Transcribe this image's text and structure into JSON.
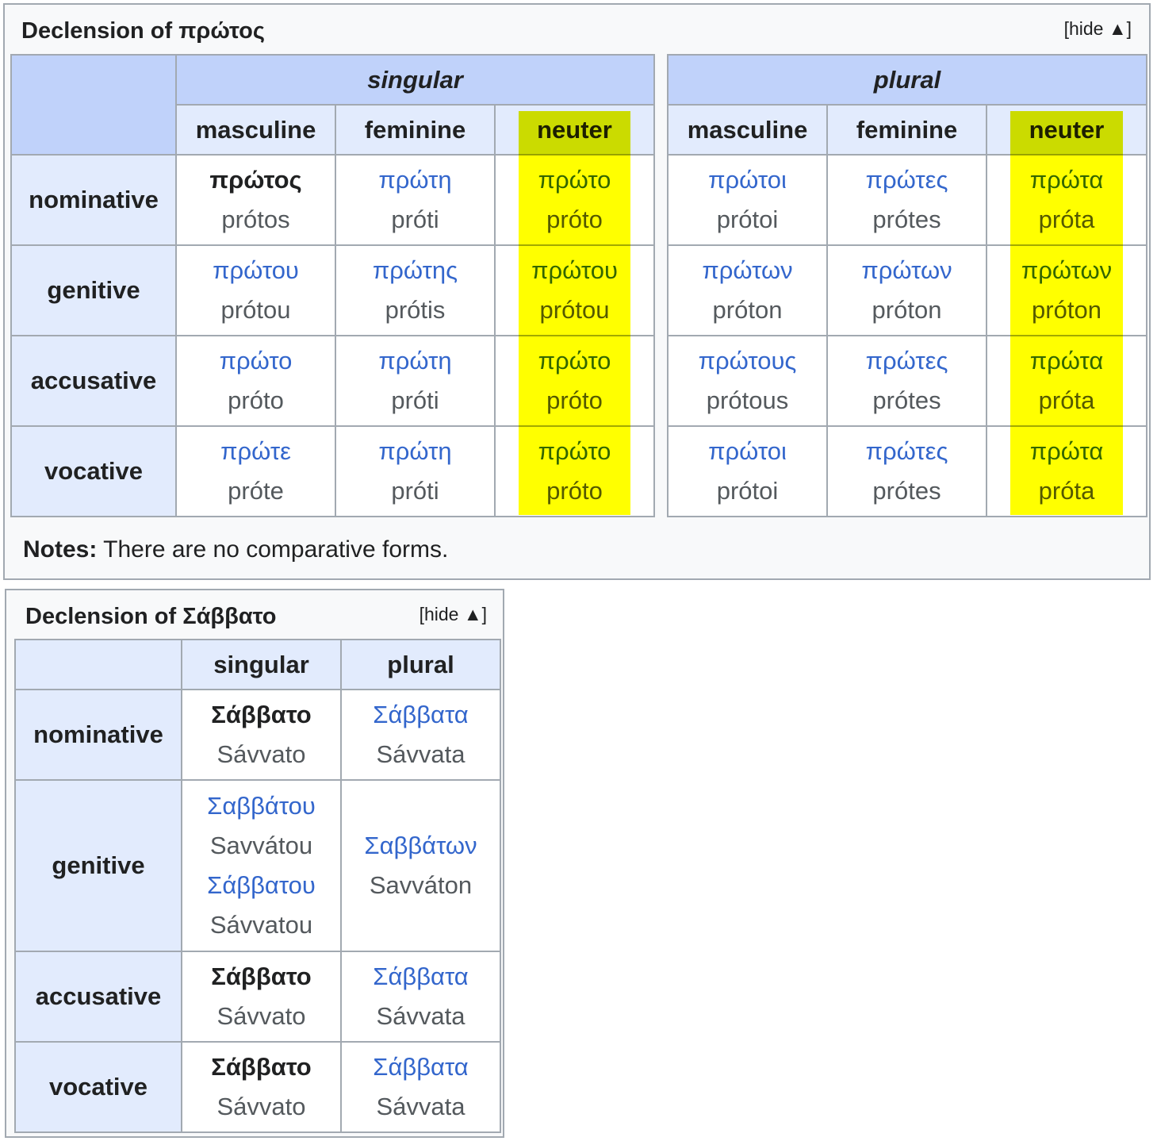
{
  "box1": {
    "title": "Declension of πρώτος",
    "hide_label": "[hide ▲]",
    "singular_label": "singular",
    "plural_label": "plural",
    "genders": [
      "masculine",
      "feminine",
      "neuter"
    ],
    "cases": [
      "nominative",
      "genitive",
      "accusative",
      "vocative"
    ],
    "singular": [
      [
        {
          "g": "πρώτος",
          "t": "prótos"
        },
        {
          "g": "πρώτη",
          "t": "próti"
        },
        {
          "g": "πρώτο",
          "t": "próto"
        }
      ],
      [
        {
          "g": "πρώτου",
          "t": "prótou"
        },
        {
          "g": "πρώτης",
          "t": "prótis"
        },
        {
          "g": "πρώτου",
          "t": "prótou"
        }
      ],
      [
        {
          "g": "πρώτο",
          "t": "próto"
        },
        {
          "g": "πρώτη",
          "t": "próti"
        },
        {
          "g": "πρώτο",
          "t": "próto"
        }
      ],
      [
        {
          "g": "πρώτε",
          "t": "próte"
        },
        {
          "g": "πρώτη",
          "t": "próti"
        },
        {
          "g": "πρώτο",
          "t": "próto"
        }
      ]
    ],
    "plural": [
      [
        {
          "g": "πρώτοι",
          "t": "prótoi"
        },
        {
          "g": "πρώτες",
          "t": "prótes"
        },
        {
          "g": "πρώτα",
          "t": "próta"
        }
      ],
      [
        {
          "g": "πρώτων",
          "t": "próton"
        },
        {
          "g": "πρώτων",
          "t": "próton"
        },
        {
          "g": "πρώτων",
          "t": "próton"
        }
      ],
      [
        {
          "g": "πρώτους",
          "t": "prótous"
        },
        {
          "g": "πρώτες",
          "t": "prótes"
        },
        {
          "g": "πρώτα",
          "t": "próta"
        }
      ],
      [
        {
          "g": "πρώτοι",
          "t": "prótoi"
        },
        {
          "g": "πρώτες",
          "t": "prótes"
        },
        {
          "g": "πρώτα",
          "t": "próta"
        }
      ]
    ],
    "notes_label": "Notes:",
    "notes_text": "There are no comparative forms.",
    "highlight_color": "#ffff00"
  },
  "box2": {
    "title": "Declension of Σάββατο",
    "hide_label": "[hide ▲]",
    "columns": [
      "singular",
      "plural"
    ],
    "cases": [
      "nominative",
      "genitive",
      "accusative",
      "vocative"
    ],
    "rows": [
      {
        "singular": [
          {
            "g": "Σάββατο",
            "t": "Sávvato"
          }
        ],
        "plural": [
          {
            "g": "Σάββατα",
            "t": "Sávvata"
          }
        ]
      },
      {
        "singular": [
          {
            "g": "Σαββάτου",
            "t": "Savvátou"
          },
          {
            "g": "Σάββατου",
            "t": "Sávvatou"
          }
        ],
        "plural": [
          {
            "g": "Σαββάτων",
            "t": "Savváton"
          }
        ]
      },
      {
        "singular": [
          {
            "g": "Σάββατο",
            "t": "Sávvato"
          }
        ],
        "plural": [
          {
            "g": "Σάββατα",
            "t": "Sávvata"
          }
        ]
      },
      {
        "singular": [
          {
            "g": "Σάββατο",
            "t": "Sávvato"
          }
        ],
        "plural": [
          {
            "g": "Σάββατα",
            "t": "Sávvata"
          }
        ]
      }
    ]
  },
  "colors": {
    "header_dark": "#c0d2fa",
    "header_light": "#e2ebfd",
    "link": "#3366cc",
    "border": "#a2a9b1"
  }
}
